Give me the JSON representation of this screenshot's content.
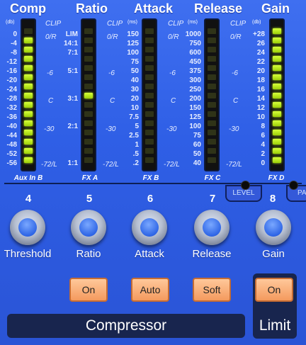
{
  "meters": [
    {
      "title": "Comp",
      "scale": [
        "0",
        "-4",
        "-8",
        "-12",
        "-16",
        "-20",
        "-24",
        "-28",
        "-32",
        "-36",
        "-40",
        "-44",
        "-48",
        "-52",
        "-56"
      ],
      "unit": "(db)",
      "channel": "Aux In B",
      "lit_fraction": 0.95
    },
    {
      "title": "Ratio",
      "scale": [
        "LIM",
        "14:1",
        "7:1",
        "5:1",
        "3:1",
        "2:1",
        "1:1"
      ],
      "unit": "",
      "channel": "FX A",
      "lit_fraction": 0.0
    },
    {
      "title": "Attack",
      "scale": [
        "150",
        "125",
        "100",
        "75",
        "50",
        "40",
        "30",
        "20",
        "10",
        "7.5",
        "5",
        "2.5",
        "1",
        ".5",
        ".2"
      ],
      "unit": "(ms)",
      "channel": "FX B",
      "lit_fraction": 0.0
    },
    {
      "title": "Release",
      "scale": [
        "1000",
        "750",
        "600",
        "450",
        "375",
        "300",
        "250",
        "200",
        "150",
        "125",
        "100",
        "75",
        "60",
        "50",
        "40"
      ],
      "unit": "(ms)",
      "channel": "FX C",
      "lit_fraction": 0.0
    },
    {
      "title": "Gain",
      "scale": [
        "+28",
        "26",
        "24",
        "22",
        "20",
        "18",
        "16",
        "14",
        "12",
        "10",
        "8",
        "6",
        "4",
        "2",
        "0"
      ],
      "unit": "(db)",
      "channel": "FX D",
      "lit_fraction": 1.0
    }
  ],
  "side_labels": {
    "clip": "CLIP",
    "or": "0/R",
    "m6": "-6",
    "c": "C",
    "m30": "-30",
    "m72": "-72/L"
  },
  "level_label": "LEVEL",
  "pa_label": "PA",
  "knobs": [
    {
      "number": "4",
      "label": "Threshold"
    },
    {
      "number": "5",
      "label": "Ratio"
    },
    {
      "number": "6",
      "label": "Attack"
    },
    {
      "number": "7",
      "label": "Release"
    },
    {
      "number": "8",
      "label": "Gain"
    }
  ],
  "buttons": {
    "on": "On",
    "auto": "Auto",
    "soft": "Soft",
    "limit_on": "On"
  },
  "sections": {
    "compressor": "Compressor",
    "limit": "Limit"
  },
  "colors": {
    "panel": "#2f5fe6",
    "led_on": "#b8ef1a",
    "button": "#f6a46a",
    "bar": "#18254e"
  }
}
